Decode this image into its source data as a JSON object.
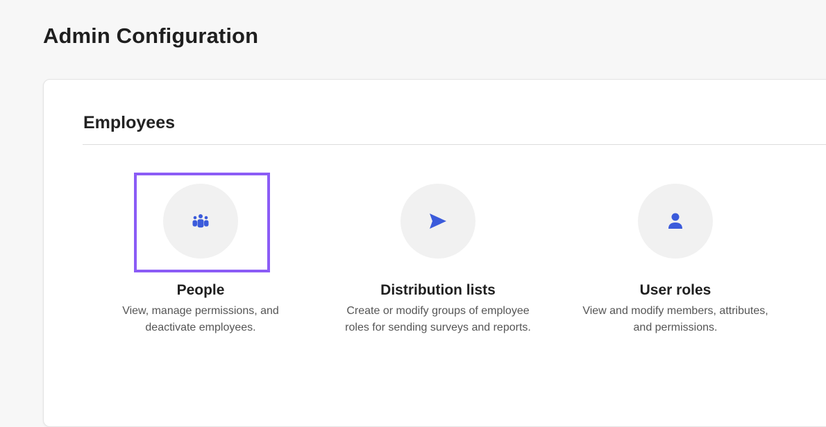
{
  "page": {
    "title": "Admin Configuration"
  },
  "section": {
    "title": "Employees"
  },
  "cards": [
    {
      "icon": "people-group-icon",
      "title": "People",
      "description": "View, manage permissions, and deactivate employees.",
      "selected": true
    },
    {
      "icon": "paper-plane-send-icon",
      "title": "Distribution lists",
      "description": "Create or modify groups of employee roles for sending surveys and reports.",
      "selected": false
    },
    {
      "icon": "user-icon",
      "title": "User roles",
      "description": "View and modify members, attributes, and permissions.",
      "selected": false
    }
  ],
  "colors": {
    "icon": "#3b5bdb",
    "selection_border": "#8b5cf6",
    "icon_circle_bg": "#f1f1f1",
    "page_bg": "#f7f7f7",
    "panel_bg": "#ffffff"
  }
}
